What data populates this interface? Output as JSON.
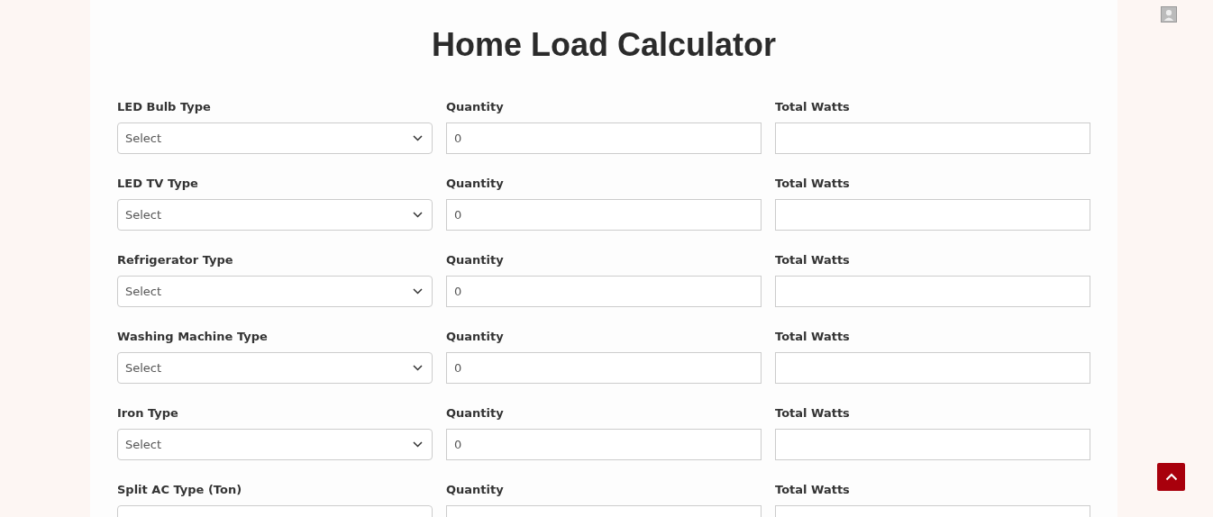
{
  "title": "Home Load Calculator",
  "rows": [
    {
      "appliance_label": "LED Bulb Type",
      "select": "Select",
      "quantity_label": "Quantity",
      "quantity": "0",
      "total_label": "Total Watts"
    },
    {
      "appliance_label": "LED TV Type",
      "select": "Select",
      "quantity_label": "Quantity",
      "quantity": "0",
      "total_label": "Total Watts"
    },
    {
      "appliance_label": "Refrigerator Type",
      "select": "Select",
      "quantity_label": "Quantity",
      "quantity": "0",
      "total_label": "Total Watts"
    },
    {
      "appliance_label": "Washing Machine Type",
      "select": "Select",
      "quantity_label": "Quantity",
      "quantity": "0",
      "total_label": "Total Watts"
    },
    {
      "appliance_label": "Iron Type",
      "select": "Select",
      "quantity_label": "Quantity",
      "quantity": "0",
      "total_label": "Total Watts"
    },
    {
      "appliance_label": "Split AC Type (Ton)",
      "quantity_label": "Quantity",
      "total_label": "Total Watts"
    }
  ]
}
